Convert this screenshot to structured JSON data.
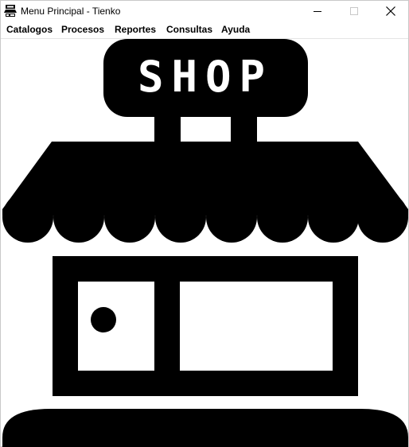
{
  "window": {
    "title": "Menu Principal - Tienko",
    "app_icon": "shop-icon",
    "controls": [
      "minimize-icon",
      "maximize-icon",
      "close-icon"
    ]
  },
  "menu": {
    "items": [
      {
        "label": "Catalogos"
      },
      {
        "label": "Procesos"
      },
      {
        "label": "Reportes"
      },
      {
        "label": "Consultas"
      },
      {
        "label": "Ayuda"
      }
    ]
  },
  "main": {
    "illustration": "shop-illustration",
    "sign_text": "SHOP",
    "colors": {
      "fill": "#000000",
      "background": "#ffffff"
    }
  }
}
